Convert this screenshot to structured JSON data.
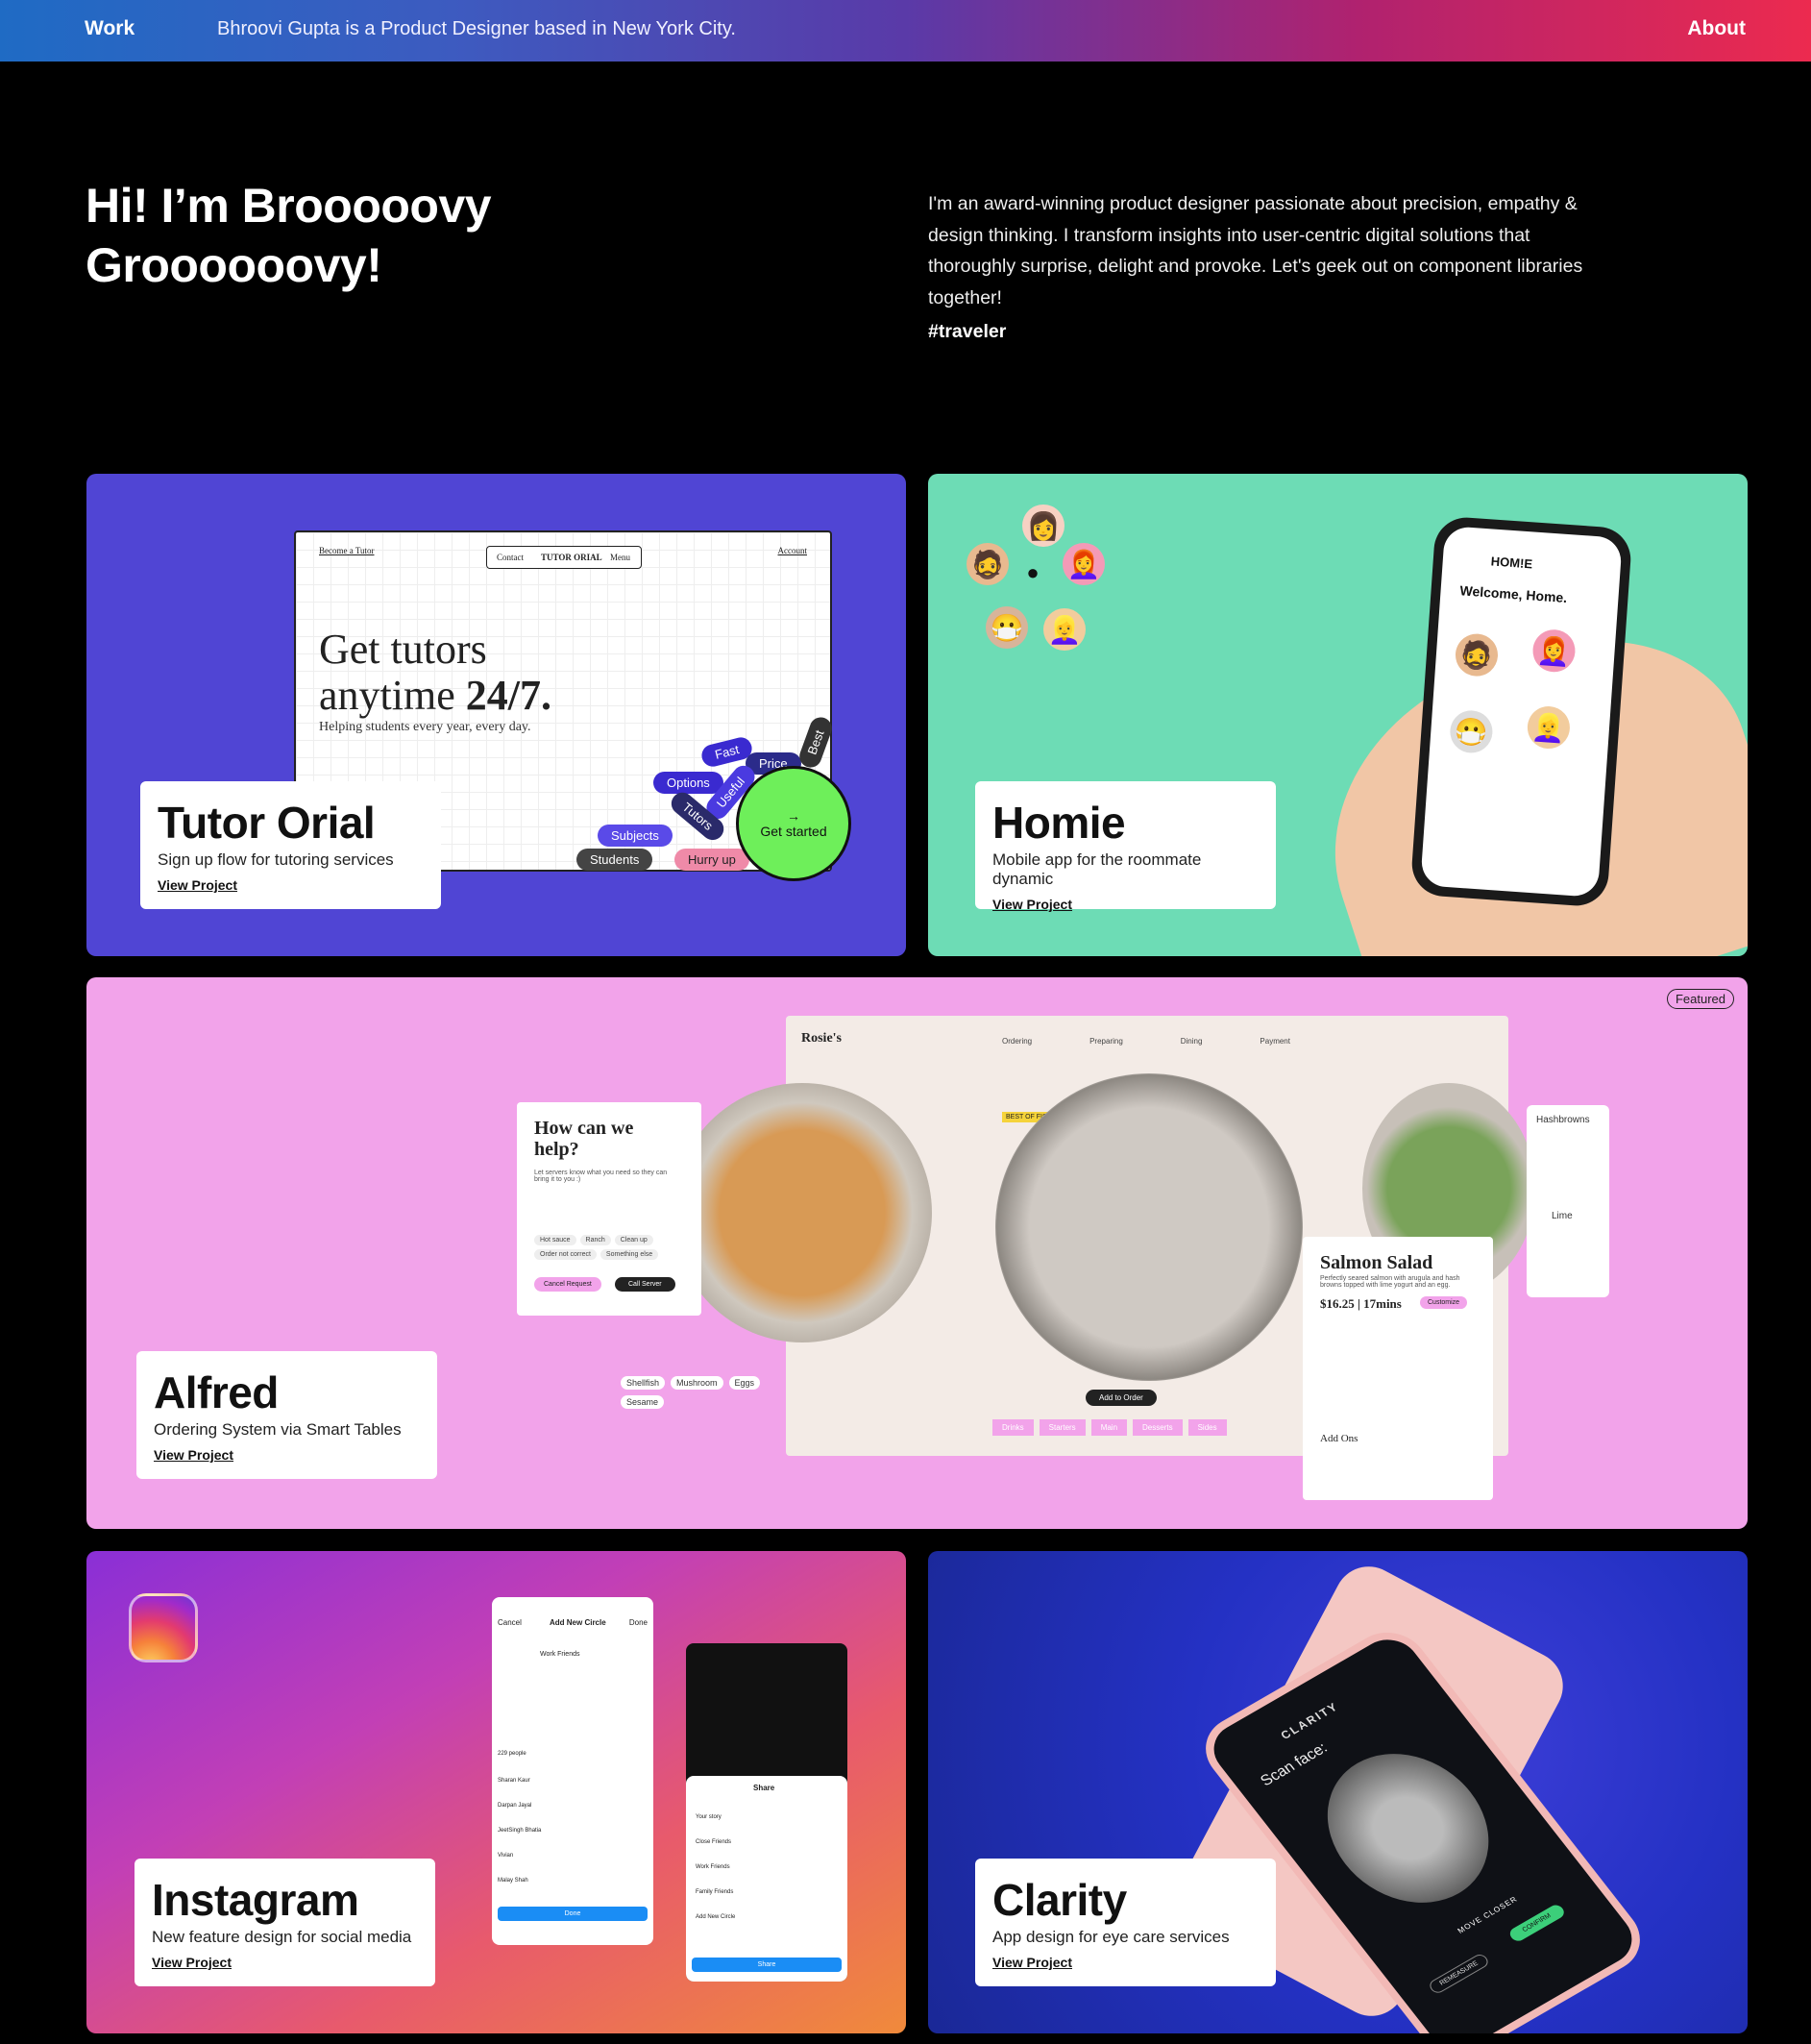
{
  "nav": {
    "work": "Work",
    "tagline": "Bhroovi Gupta is a Product Designer based in New York City.",
    "about": "About"
  },
  "hero": {
    "title_line1": "Hi! I’m Brooooovy",
    "title_line2": "Groooooovy!",
    "bio": "I'm an award-winning product designer passionate about precision, empathy & design thinking. I transform insights into user-centric digital solutions that thoroughly surprise, delight and provoke. Let's geek out on component libraries together!",
    "tag": "#traveler"
  },
  "projects": {
    "tutor": {
      "title": "Tutor Orial",
      "subtitle": "Sign up flow for tutoring services",
      "link": "View Project",
      "mock": {
        "nav_left": "Become a Tutor",
        "nav_contact": "Contact",
        "nav_brand": "TUTOR ORIAL",
        "nav_menu": "Menu",
        "nav_account": "Account",
        "headline_1": "Get tutors",
        "headline_2": "anytime",
        "headline_bold": "24/7.",
        "sub": "Helping students every year, every day.",
        "chips": [
          "Fast",
          "Price",
          "Best",
          "Options",
          "Useful",
          "Tutors",
          "Subjects",
          "Students",
          "Hurry up"
        ],
        "cta": "Get started"
      }
    },
    "homie": {
      "title": "Homie",
      "subtitle": "Mobile app for the roommate dynamic",
      "link": "View Project",
      "mock": {
        "brand": "HOM!E",
        "welcome": "Welcome, Home."
      }
    },
    "alfred": {
      "badge": "Featured",
      "title": "Alfred",
      "subtitle": "Ordering System via Smart Tables",
      "link": "View Project",
      "mock": {
        "brand": "Rosie's",
        "steps": [
          "Ordering",
          "Preparing",
          "Dining",
          "Payment"
        ],
        "help_title": "How can we help?",
        "help_sub": "Let servers know what you need so they can bring it to you :)",
        "help_chips": [
          "Hot sauce",
          "Ranch",
          "Clean up",
          "Order not correct",
          "Something else"
        ],
        "cancel": "Cancel Request",
        "call": "Call Server",
        "best": "BEST OF FISH",
        "add_to_order": "Add to Order",
        "dish": "Salmon Salad",
        "dish_desc": "Perfectly seared salmon with arugula and hash browns topped with lime yogurt and an egg.",
        "price": "$16.25 | 17mins",
        "customize": "Customize",
        "add_ons": "Add Ons",
        "categories": [
          "Drinks",
          "Starters",
          "Main",
          "Desserts",
          "Sides"
        ],
        "allergens": [
          "Shellfish",
          "Mushroom",
          "Eggs",
          "Sesame"
        ],
        "side_items": [
          "Hashbrowns",
          "Lime"
        ]
      }
    },
    "instagram": {
      "title": "Instagram",
      "subtitle": "New feature design for social media",
      "link": "View Project",
      "mock": {
        "header": "Add New Circle",
        "cancel": "Cancel",
        "done": "Done",
        "circle_name": "Work Friends",
        "people_count": "229 people",
        "people": [
          "Sharan Kaur",
          "Darpan Jayal",
          "JeetSingh Bhatia",
          "Vivian",
          "Malay Shah"
        ],
        "share": "Share",
        "share_items": [
          "Your story",
          "Close Friends",
          "Work Friends",
          "Family Friends",
          "Add New Circle"
        ],
        "done_btn": "Done",
        "share_btn": "Share"
      }
    },
    "clarity": {
      "title": "Clarity",
      "subtitle": "App design for eye care services",
      "link": "View Project",
      "mock": {
        "brand": "CLARITY",
        "scan": "Scan face:",
        "move": "MOVE CLOSER",
        "confirm": "CONFIRM",
        "remeasure": "REMEASURE"
      }
    }
  },
  "colors": {
    "tutor_bg": "#5045d4",
    "homie_bg": "#6ddcb5",
    "alfred_bg": "#f2a3ea",
    "accent_green": "#6eef5a"
  }
}
